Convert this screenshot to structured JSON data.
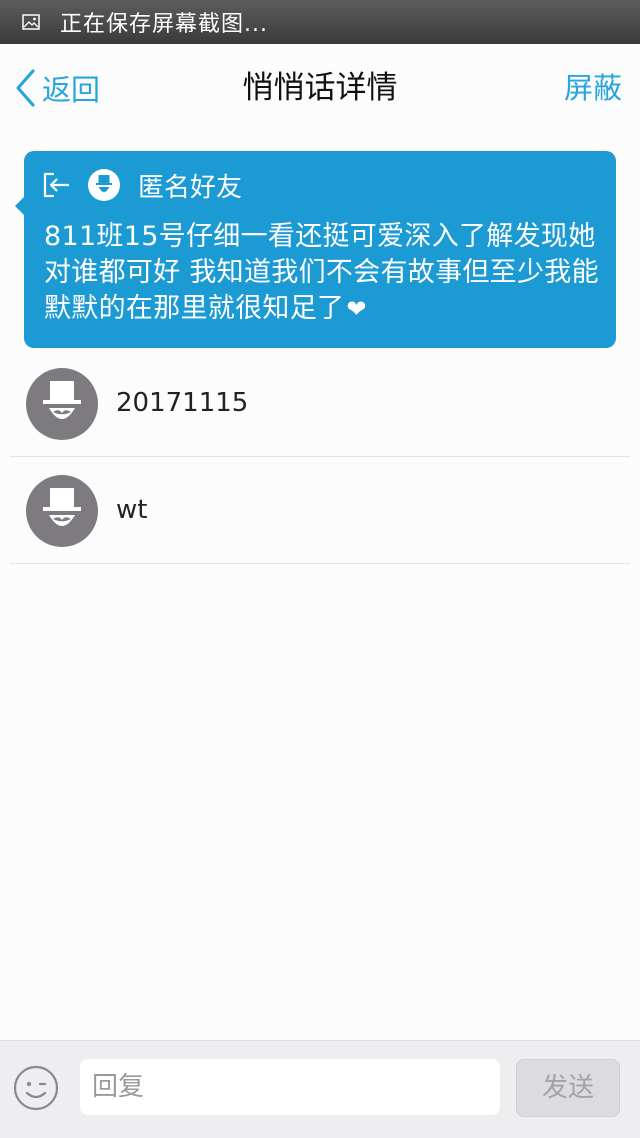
{
  "status_bar": {
    "text": "正在保存屏幕截图..."
  },
  "nav": {
    "back_label": "返回",
    "title": "悄悄话详情",
    "block_label": "屏蔽"
  },
  "message": {
    "sender": "匿名好友",
    "body": "811班15号仔细一看还挺可爱深入了解发现她对谁都可好 我知道我们不会有故事但至少我能默默的在那里就很知足了",
    "heart": "❤"
  },
  "replies": [
    {
      "name": "20171115"
    },
    {
      "name": "wt"
    }
  ],
  "reply_bar": {
    "placeholder": "回复",
    "send_label": "发送"
  },
  "colors": {
    "accent": "#26a6dc",
    "card": "#1b9ad4",
    "avatar": "#7d7b80"
  }
}
